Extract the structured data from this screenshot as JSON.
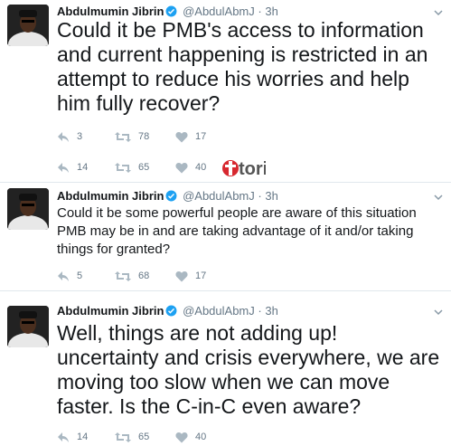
{
  "tweets": [
    {
      "name": "Abdulmumin Jibrin",
      "handle": "@AbdulAbmJ",
      "dot": "·",
      "time": "3h",
      "text": "Could it be PMB's access to information and current happening is restricted in an attempt to reduce his worries and help him fully recover?",
      "reply_count": "3",
      "retweet_count": "78",
      "like_count": "17"
    },
    {
      "name": "Abdulmumin Jibrin",
      "handle": "@AbdulAbmJ",
      "dot": "·",
      "time": "3h",
      "text": "Could it be some powerful people are aware of this situation PMB may be in and are taking advantage of it and/or taking things for granted?",
      "reply_count": "5",
      "retweet_count": "68",
      "like_count": "17"
    },
    {
      "name": "Abdulmumin Jibrin",
      "handle": "@AbdulAbmJ",
      "dot": "·",
      "time": "3h",
      "text": "Well, things are not adding up! uncertainty and crisis everywhere, we are moving too slow when we can move faster. Is the C-in-C even aware?",
      "reply_count": "14",
      "retweet_count": "65",
      "like_count": "40"
    }
  ],
  "extra_actions": {
    "reply_count": "14",
    "retweet_count": "65",
    "like_count": "40"
  },
  "watermark": {
    "text": "tori"
  },
  "colors": {
    "text": "#14171a",
    "muted": "#657786",
    "verified": "#1da1f2",
    "watermark_red": "#d7282f"
  }
}
